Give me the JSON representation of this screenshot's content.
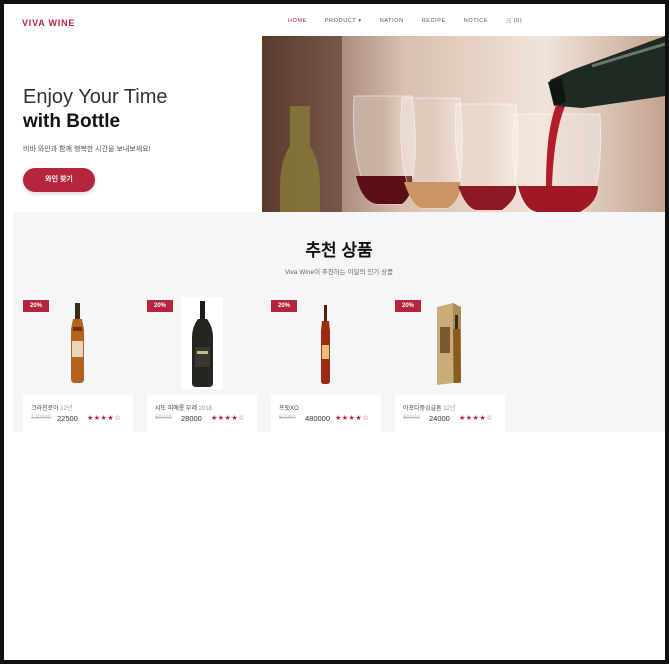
{
  "brand": {
    "logo": "VIVA WINE",
    "accent": "#b5253e"
  },
  "nav": {
    "items": [
      {
        "label": "HOME",
        "active": true
      },
      {
        "label": "PRODUCT ▾",
        "active": false
      },
      {
        "label": "NATION",
        "active": false
      },
      {
        "label": "RECIPE",
        "active": false
      },
      {
        "label": "NOTICE",
        "active": false
      },
      {
        "label": "🛒(0)",
        "active": false
      }
    ]
  },
  "hero": {
    "line1": "Enjoy Your Time",
    "line2": "with Bottle",
    "subtitle": "비바 와인과 함께 행복한 시간을 보내보세요!",
    "button": "와인 찾기"
  },
  "recommended": {
    "title": "추천 상품",
    "subtitle": "Viva Wine이 추천하는 이달의 인기 상품",
    "products": [
      {
        "badge": "20%",
        "name": "크라천로아 ",
        "year": "12년",
        "old_price": "120000",
        "price": "22500",
        "stars": "★★★★☆",
        "bottle": "cognac"
      },
      {
        "badge": "20%",
        "name": "샤또 피에롱 부레 ",
        "year": "2018",
        "old_price": "50000",
        "price": "28000",
        "stars": "★★★★☆",
        "bottle": "dark"
      },
      {
        "badge": "20%",
        "name": "프릿XO",
        "year": "",
        "old_price": "60000",
        "price": "480000",
        "stars": "★★★★☆",
        "bottle": "thin"
      },
      {
        "badge": "20%",
        "name": "아포타중싱글톤 ",
        "year": "12년",
        "old_price": "90000",
        "price": "24000",
        "stars": "★★★★☆",
        "bottle": "boxed"
      }
    ]
  }
}
